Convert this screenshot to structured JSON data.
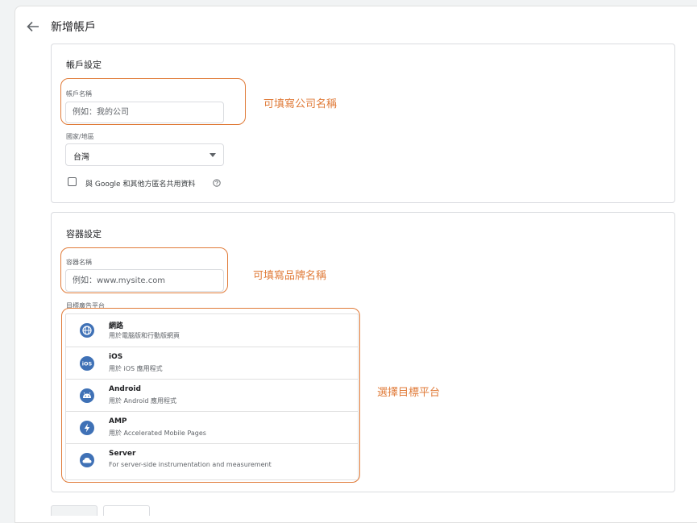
{
  "header": {
    "title": "新增帳戶"
  },
  "account": {
    "section_title": "帳戶設定",
    "name_label": "帳戶名稱",
    "name_placeholder": "例如：我的公司",
    "country_label": "國家/地區",
    "country_value": "台灣",
    "share_label": "與 Google 和其他方匿名共用資料"
  },
  "container": {
    "section_title": "容器設定",
    "name_label": "容器名稱",
    "name_placeholder": "例如：www.mysite.com",
    "platform_label": "目標廣告平台",
    "platforms": [
      {
        "name": "網路",
        "desc": "用於電腦版和行動版網頁",
        "icon": "globe-icon"
      },
      {
        "name": "iOS",
        "desc": "用於 iOS 應用程式",
        "icon": "ios-icon"
      },
      {
        "name": "Android",
        "desc": "用於 Android 應用程式",
        "icon": "android-icon"
      },
      {
        "name": "AMP",
        "desc": "用於 Accelerated Mobile Pages",
        "icon": "amp-bolt-icon"
      },
      {
        "name": "Server",
        "desc": "For server-side instrumentation and measurement",
        "icon": "cloud-icon"
      }
    ]
  },
  "annotations": {
    "company": "可填寫公司名稱",
    "brand": "可填寫品牌名稱",
    "platform": "選擇目標平台"
  },
  "colors": {
    "accent": "#e07b39",
    "platform_icon": "#3f71b6"
  }
}
